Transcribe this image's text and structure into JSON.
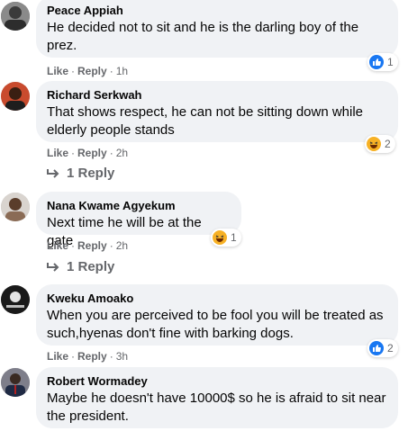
{
  "comments": [
    {
      "author": "Peace Appiah",
      "text_lines": [
        "He decided not to sit and he is the darling boy of the",
        "prez."
      ],
      "like": "Like",
      "reply": "Reply",
      "time": "1h",
      "reaction_count": "1",
      "reaction": "like-icon"
    },
    {
      "author": "Richard Serkwah",
      "text_lines": [
        "That shows respect, he can not be sitting down while",
        "elderly people stands"
      ],
      "like": "Like",
      "reply": "Reply",
      "time": "2h",
      "reaction_count": "2",
      "reaction": "haha-icon",
      "replies_label": "1 Reply"
    },
    {
      "author": "Nana Kwame Agyekum",
      "text_lines": [
        "Next time he will be at the gate"
      ],
      "like": "Like",
      "reply": "Reply",
      "time": "2h",
      "reaction_count": "1",
      "reaction": "haha-icon",
      "replies_label": "1 Reply"
    },
    {
      "author": "Kweku Amoako",
      "text_lines": [
        "When you are perceived to be fool you will be treated as",
        "such,hyenas don't fine with barking dogs."
      ],
      "like": "Like",
      "reply": "Reply",
      "time": "3h",
      "reaction_count": "2",
      "reaction": "like-icon"
    },
    {
      "author": "Robert Wormadey",
      "text_lines": [
        "Maybe he doesn't have 10000$ so he is afraid to sit near",
        "the president."
      ]
    }
  ],
  "colors": {
    "bubble": "#f0f2f5",
    "like_blue": "#1877f2",
    "haha_yellow": "#f7b125",
    "meta_gray": "#65676b"
  }
}
